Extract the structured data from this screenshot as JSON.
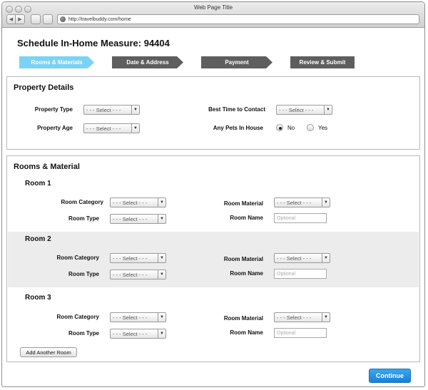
{
  "browser": {
    "window_title": "Web Page Title",
    "url": "http://travelbuddy.com/home",
    "back_glyph": "◀",
    "forward_glyph": "▶"
  },
  "page": {
    "title": "Schedule In-Home Measure: 94404"
  },
  "steps": [
    {
      "label": "Rooms & Materials",
      "state": "active"
    },
    {
      "label": "Date & Address",
      "state": "inactive"
    },
    {
      "label": "Payment",
      "state": "inactive"
    },
    {
      "label": "Review & Submit",
      "state": "inactive"
    }
  ],
  "property": {
    "heading": "Property Details",
    "property_type_label": "Property Type",
    "property_type_value": "- - - Select - - -",
    "property_age_label": "Property Age",
    "property_age_value": "- - - Select - - -",
    "best_time_label": "Best Time to  Contact",
    "best_time_value": "- - - Select - - -",
    "pets_label": "Any Pets In House",
    "pets_options": [
      "No",
      "Yes"
    ],
    "pets_selected": "No"
  },
  "rooms": {
    "heading": "Rooms & Material",
    "list": [
      {
        "title": "Room 1",
        "category_label": "Room Category",
        "category_value": "- - - Select - - -",
        "type_label": "Room Type",
        "type_value": "- - - Select - - -",
        "material_label": "Room Material",
        "material_value": "- - - Select - - -",
        "name_label": "Room Name",
        "name_placeholder": "Optional"
      },
      {
        "title": "Room 2",
        "category_label": "Room Category",
        "category_value": "- - - Select - - -",
        "type_label": "Room Type",
        "type_value": "- - - Select - - -",
        "material_label": "Room Material",
        "material_value": "- - - Select - - -",
        "name_label": "Room Name",
        "name_placeholder": "Optional"
      },
      {
        "title": "Room 3",
        "category_label": "Room Category",
        "category_value": "- - - Select - - -",
        "type_label": "Room Type",
        "type_value": "- - - Select - - -",
        "material_label": "Room Material",
        "material_value": "- - - Select - - -",
        "name_label": "Room Name",
        "name_placeholder": "Optional"
      }
    ],
    "add_button": "Add Another Room"
  },
  "footer": {
    "continue_label": "Continue"
  },
  "icons": {
    "dropdown": "chevron-down-icon",
    "globe": "globe-icon"
  },
  "colors": {
    "step_active": "#7ad3f6",
    "step_inactive": "#5e5e5e",
    "continue": "#1a80d6",
    "room_band_alt": "#ececec"
  }
}
